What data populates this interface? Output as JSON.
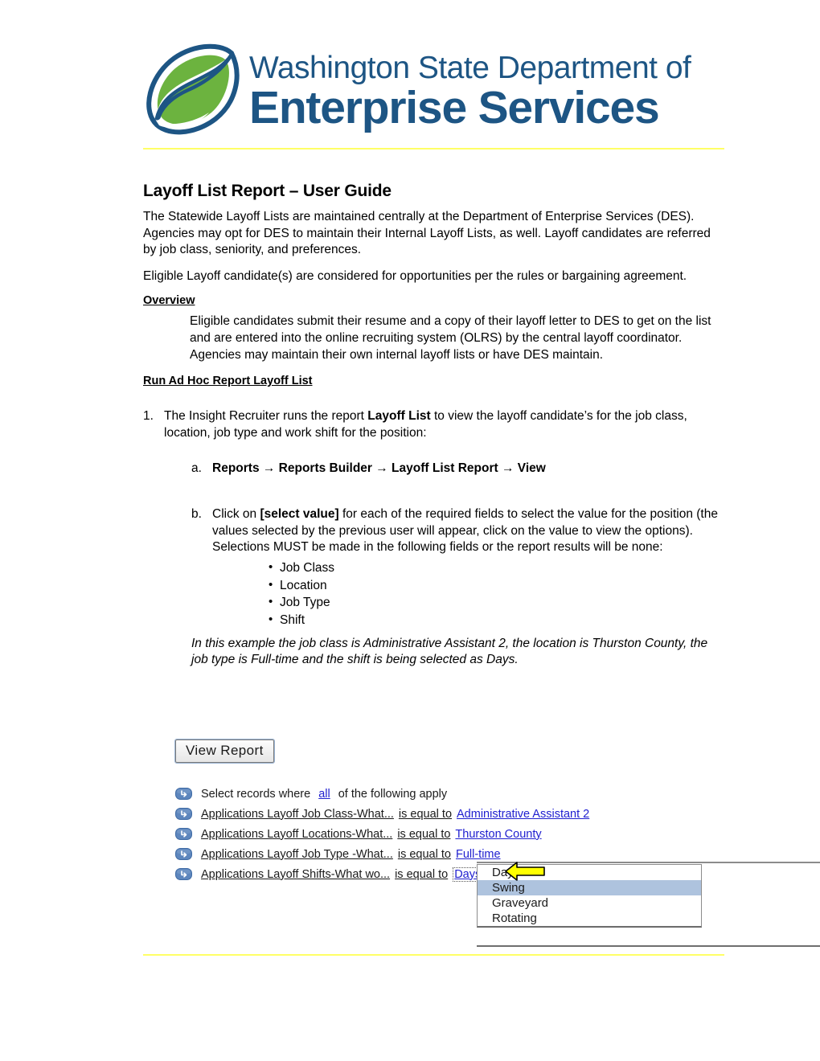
{
  "logo": {
    "line1": "Washington State Department of",
    "line2": "Enterprise Services",
    "mark_name": "leaf-swirl-logo",
    "colors": {
      "green": "#6cb33f",
      "blue": "#1d5584",
      "rule": "#ffff66"
    }
  },
  "document": {
    "title": "Layoff List Report – User Guide",
    "para1": "The Statewide Layoff Lists are maintained centrally at the Department of Enterprise Services (DES). Agencies may opt for DES to maintain their Internal Layoff Lists, as well. Layoff candidates are referred by job class, seniority, and preferences.",
    "para2": "Eligible Layoff candidate(s) are considered for opportunities per the rules or bargaining agreement.",
    "overview_heading": "Overview",
    "overview_body": "Eligible candidates submit their resume and a copy of their layoff letter to DES to get on the list and are entered into the online recruiting system (OLRS) by the central layoff coordinator. Agencies may maintain their own internal layoff lists or have DES maintain.",
    "run_heading": "Run Ad Hoc Report Layoff List",
    "step1": {
      "marker": "1.",
      "text_before": "The Insight Recruiter runs the report ",
      "bold": "Layoff List",
      "text_after": " to view the layoff candidate’s for the job class, location, job type and work shift for the position:"
    },
    "step_a": {
      "marker": "a.",
      "text": "Reports → Reports Builder → Layoff List Report → View"
    },
    "step_b": {
      "marker": "b.",
      "text_before": "Click on ",
      "bold": "[select value]",
      "text_after": " for each of the required fields to select the value for the position (the values selected by the previous user will appear, click on the value to view the options). Selections MUST be made in the following fields or the report results will be none:",
      "bullets": [
        "Job Class",
        "Location",
        "Job Type",
        "Shift"
      ]
    },
    "example_note": "In this example the job class is Administrative Assistant 2, the location is Thurston County, the job type is Full-time and the shift is being selected as Days."
  },
  "screenshot": {
    "view_report_button": "View Report",
    "intro_row": {
      "prefix": "Select records where",
      "link": "all",
      "suffix": "of the following apply"
    },
    "filters": [
      {
        "field": "Applications Layoff Job Class-What...",
        "operator": "is equal to",
        "value": "Administrative Assistant 2",
        "active": false
      },
      {
        "field": "Applications Layoff Locations-What...",
        "operator": "is equal to",
        "value": "Thurston County",
        "active": false
      },
      {
        "field": "Applications Layoff Job Type -What...",
        "operator": "is equal to",
        "value": "Full-time",
        "active": false
      },
      {
        "field": "Applications Layoff Shifts-What wo...",
        "operator": "is equal to",
        "value": "Days",
        "active": true
      }
    ],
    "dropdown": {
      "options": [
        "Days",
        "Swing",
        "Graveyard",
        "Rotating"
      ],
      "highlighted": "Swing",
      "highlight_color": "#aec3de"
    },
    "callout_arrow": {
      "name": "yellow-left-arrow",
      "color": "#ffff00"
    }
  }
}
